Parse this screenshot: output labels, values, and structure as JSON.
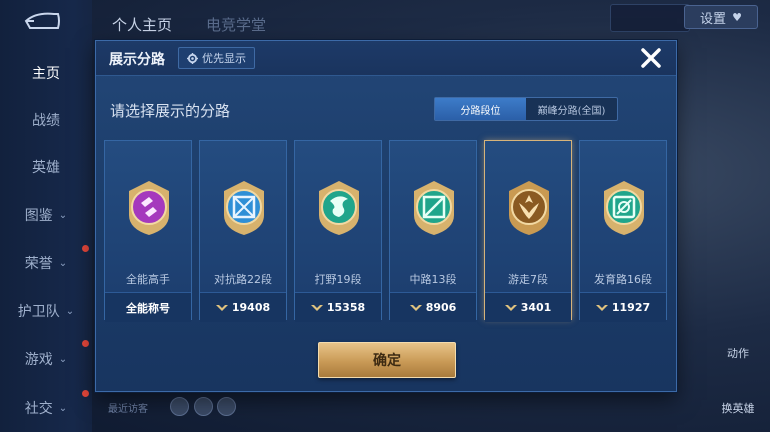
{
  "top_tabs": [
    "个人主页",
    "电竞学堂"
  ],
  "settings": {
    "label": "设置"
  },
  "nav": [
    {
      "label": "主页",
      "active": true,
      "chevron": false
    },
    {
      "label": "战绩",
      "active": false,
      "chevron": false
    },
    {
      "label": "英雄",
      "active": false,
      "chevron": false
    },
    {
      "label": "图鉴",
      "active": false,
      "chevron": true
    },
    {
      "label": "荣誉",
      "active": false,
      "chevron": true
    },
    {
      "label": "护卫队",
      "active": false,
      "chevron": true
    },
    {
      "label": "游戏",
      "active": false,
      "chevron": true
    },
    {
      "label": "社交",
      "active": false,
      "chevron": true
    }
  ],
  "recent_visitors_label": "最近访客",
  "right_buttons": {
    "first": "动作",
    "second": "换英雄"
  },
  "modal": {
    "title": "展示分路",
    "priority_label": "优先显示",
    "subtitle": "请选择展示的分路",
    "toggle": [
      {
        "label": "分路段位",
        "active": true
      },
      {
        "label": "巅峰分路(全国)",
        "active": false
      }
    ],
    "cards": [
      {
        "name": "全能高手",
        "footer": "全能称号",
        "has_points": false,
        "selected": false,
        "badge": "allround-badge-icon",
        "color": "#b548c9"
      },
      {
        "name": "对抗路22段",
        "footer": "19408",
        "has_points": true,
        "selected": false,
        "badge": "clash-lane-badge-icon",
        "color": "#2f8fd6"
      },
      {
        "name": "打野19段",
        "footer": "15358",
        "has_points": true,
        "selected": false,
        "badge": "jungle-badge-icon",
        "color": "#20a58b"
      },
      {
        "name": "中路13段",
        "footer": "8906",
        "has_points": true,
        "selected": false,
        "badge": "mid-lane-badge-icon",
        "color": "#20a58b"
      },
      {
        "name": "游走7段",
        "footer": "3401",
        "has_points": true,
        "selected": true,
        "badge": "roam-badge-icon",
        "color": "#b77a2c"
      },
      {
        "name": "发育路16段",
        "footer": "11927",
        "has_points": true,
        "selected": false,
        "badge": "farm-lane-badge-icon",
        "color": "#20a58b"
      }
    ],
    "confirm_label": "确定"
  }
}
